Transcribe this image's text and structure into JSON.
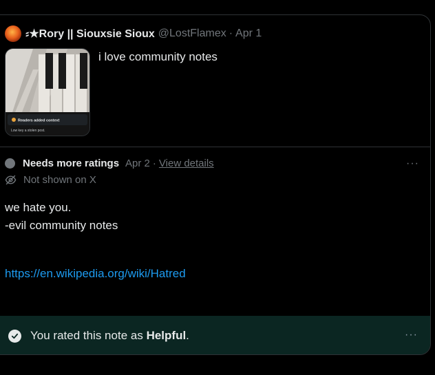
{
  "quoted_post": {
    "author_name": "⸗★Rory || Siouxsie Sioux",
    "handle": "@LostFlamex",
    "separator": "·",
    "date": "Apr 1",
    "text": "i love community notes",
    "thumbnail": {
      "banner_text": "Readers added context",
      "caption_text": "Low key a stolen post."
    }
  },
  "note": {
    "status_label": "Needs more ratings",
    "status_color": "#71767b",
    "date": "Apr 2",
    "separator": "·",
    "view_details_label": "View details",
    "visibility_text": "Not shown on X",
    "more_label": "···",
    "body_lines": [
      "we hate you.",
      "-evil community notes"
    ],
    "link": "https://en.wikipedia.org/wiki/Hatred"
  },
  "rating": {
    "prefix": "You rated this note as ",
    "value": "Helpful",
    "suffix": ".",
    "more_label": "···",
    "bar_color": "#0b2622"
  },
  "colors": {
    "background": "#000000",
    "border": "#2f3336",
    "muted_text": "#71767b",
    "link": "#1d9bf0"
  }
}
